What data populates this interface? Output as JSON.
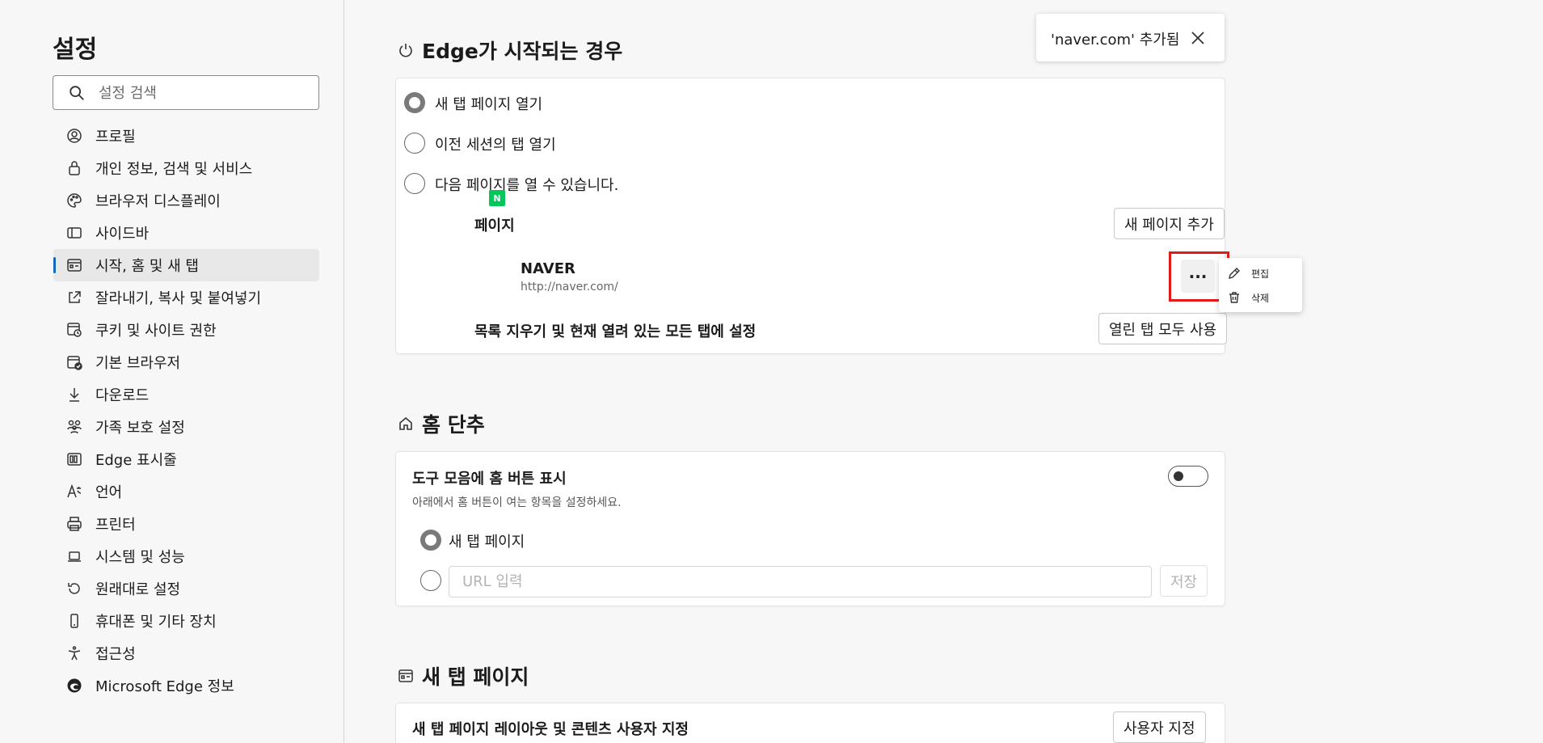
{
  "sidebar": {
    "title": "설정",
    "search_placeholder": "설정 검색",
    "items": [
      {
        "label": "프로필",
        "icon": "profile-icon"
      },
      {
        "label": "개인 정보, 검색 및 서비스",
        "icon": "lock-icon"
      },
      {
        "label": "브라우저 디스플레이",
        "icon": "palette-icon"
      },
      {
        "label": "사이드바",
        "icon": "sidebar-icon"
      },
      {
        "label": "시작, 홈 및 새 탭",
        "icon": "start-home-icon",
        "selected": true
      },
      {
        "label": "잘라내기, 복사 및 붙여넣기",
        "icon": "share-icon"
      },
      {
        "label": "쿠키 및 사이트 권한",
        "icon": "cookie-icon"
      },
      {
        "label": "기본 브라우저",
        "icon": "browser-icon"
      },
      {
        "label": "다운로드",
        "icon": "download-icon"
      },
      {
        "label": "가족 보호 설정",
        "icon": "family-icon"
      },
      {
        "label": "Edge 표시줄",
        "icon": "edge-bar-icon"
      },
      {
        "label": "언어",
        "icon": "language-icon"
      },
      {
        "label": "프린터",
        "icon": "printer-icon"
      },
      {
        "label": "시스템 및 성능",
        "icon": "laptop-icon"
      },
      {
        "label": "원래대로 설정",
        "icon": "reset-icon"
      },
      {
        "label": "휴대폰 및 기타 장치",
        "icon": "phone-icon"
      },
      {
        "label": "접근성",
        "icon": "accessibility-icon"
      },
      {
        "label": "Microsoft Edge 정보",
        "icon": "edge-logo-icon"
      }
    ]
  },
  "startup": {
    "title": "Edge가 시작되는 경우",
    "options": [
      {
        "label": "새 탭 페이지 열기",
        "checked": true
      },
      {
        "label": "이전 세션의 탭 열기",
        "checked": false
      },
      {
        "label": "다음 페이지를 열 수 있습니다.",
        "checked": false
      }
    ],
    "pages_label": "페이지",
    "add_page_button": "새 페이지 추가",
    "page_entry": {
      "name": "NAVER",
      "url": "http://naver.com/",
      "logo_letter": "N"
    },
    "more_button": "···",
    "clear_label": "목록 지우기 및 현재 열려 있는 모든 탭에 설정",
    "use_open_tabs_button": "열린 탭 모두 사용"
  },
  "toast": {
    "text": "'naver.com' 추가됨"
  },
  "context_menu": {
    "edit": "편집",
    "delete": "삭제"
  },
  "home": {
    "title": "홈 단추",
    "show_home_label": "도구 모음에 홈 버튼 표시",
    "show_home_desc": "아래에서 홈 버튼이 여는 항목을 설정하세요.",
    "toggle_on": false,
    "option_new_tab": "새 탭 페이지",
    "url_placeholder": "URL 입력",
    "save_button": "저장"
  },
  "new_tab": {
    "title": "새 탭 페이지",
    "customize_label": "새 탭 페이지 레이아웃 및 콘텐츠 사용자 지정",
    "customize_button": "사용자 지정"
  }
}
